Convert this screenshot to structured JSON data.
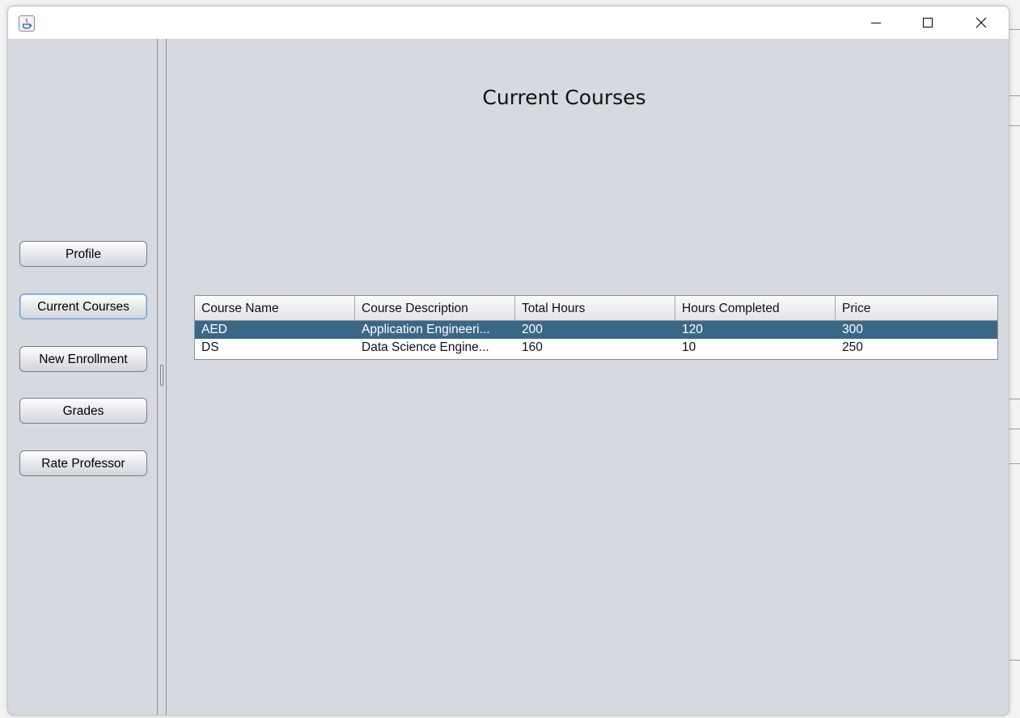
{
  "window": {
    "title": ""
  },
  "sidebar": {
    "items": [
      {
        "label": "Profile"
      },
      {
        "label": "Current Courses"
      },
      {
        "label": "New Enrollment"
      },
      {
        "label": "Grades"
      },
      {
        "label": "Rate Professor"
      }
    ]
  },
  "main": {
    "title": "Current Courses",
    "table": {
      "columns": [
        "Course Name",
        "Course Description",
        "Total Hours",
        "Hours Completed",
        "Price"
      ],
      "rows": [
        [
          "AED",
          "Application Engineeri...",
          "200",
          "120",
          "300"
        ],
        [
          "DS",
          "Data Science Engine...",
          "160",
          "10",
          "250"
        ]
      ],
      "selected_row": 0
    }
  },
  "colors": {
    "selection": "#3b6787",
    "background": "#d6d9e0",
    "focus_ring": "#6d9ac9"
  },
  "icons": {
    "app": "java-icon",
    "minimize": "minimize-icon",
    "maximize": "maximize-icon",
    "close": "close-icon"
  }
}
